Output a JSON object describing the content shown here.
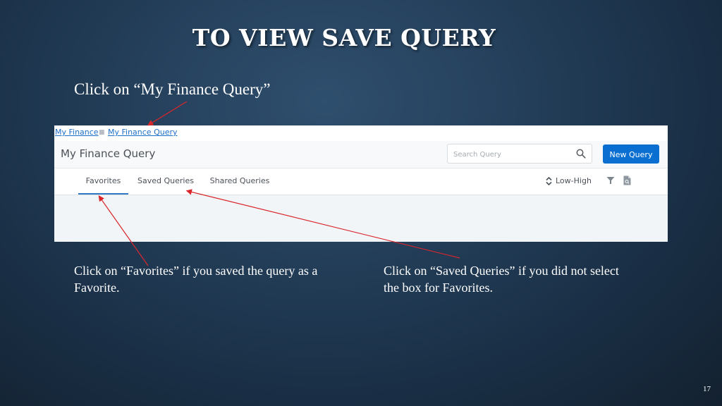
{
  "slide": {
    "title": "TO VIEW SAVE QUERY",
    "instruction_top": "Click on “My Finance Query”",
    "instruction_left": "Click on “Favorites” if you saved the query as a Favorite.",
    "instruction_right": "Click on “Saved Queries” if you did not select the box for Favorites.",
    "page_number": "17",
    "arrow_color": "#d9262b"
  },
  "app": {
    "breadcrumb": [
      "My Finance",
      "My Finance Query"
    ],
    "breadcrumb_separator": "■",
    "page_title": "My Finance Query",
    "search": {
      "placeholder": "Search Query",
      "value": ""
    },
    "new_query_label": "New Query",
    "tabs": [
      {
        "label": "Favorites",
        "active": true
      },
      {
        "label": "Saved Queries",
        "active": false
      },
      {
        "label": "Shared Queries",
        "active": false
      }
    ],
    "sort_label": "Low-High",
    "icons": [
      "search-icon",
      "sort-icon",
      "filter-icon",
      "export-icon"
    ],
    "colors": {
      "primary": "#0b6fd1",
      "link": "#1f6fc7",
      "active_tab": "#2f78c4"
    }
  }
}
